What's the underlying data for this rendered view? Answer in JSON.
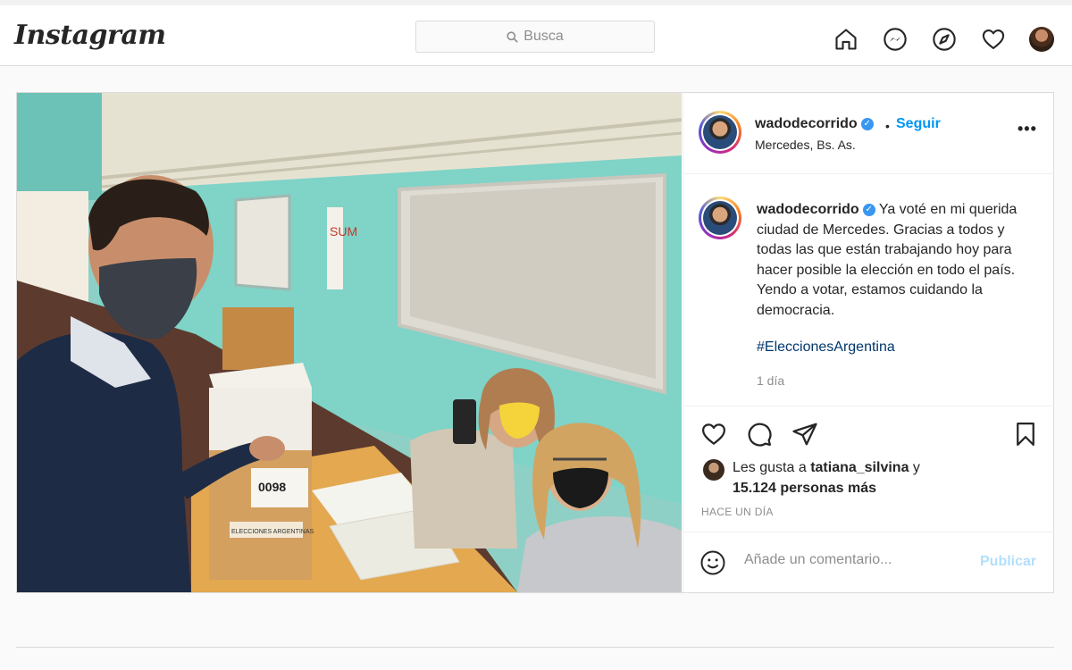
{
  "app": {
    "logo": "Instagram"
  },
  "search": {
    "placeholder": "Busca"
  },
  "nav_icons": [
    "home-icon",
    "messenger-icon",
    "explore-icon",
    "heart-icon",
    "profile-avatar"
  ],
  "post": {
    "author": "wadodecorrido",
    "verified": true,
    "dot": "•",
    "follow_label": "Seguir",
    "location": "Mercedes, Bs. As.",
    "more_label": "•••",
    "caption_text": "Ya voté en mi querida ciudad de Mercedes. Gracias a todos y todas las que están trabajando hoy para hacer posible la elección en todo el país. Yendo a votar, estamos cuidando la democracia.",
    "hashtag": "#EleccionesArgentina",
    "caption_time": "1 día",
    "likes_prefix": "Les gusta a",
    "likes_user": "tatiana_silvina",
    "likes_and": "y",
    "likes_count": "15.124 personas más",
    "time_ago": "HACE UN DÍA",
    "comment_placeholder": "Añade un comentario...",
    "publish_label": "Publicar"
  },
  "photo": {
    "ballot_box_number": "0098",
    "sign_text": "SUM",
    "box_label": "ELECCIONES ARGENTINAS"
  },
  "colors": {
    "accent": "#0095f6",
    "hashtag": "#00376b",
    "publish_disabled": "#b2dffc",
    "border": "#dbdbdb"
  }
}
